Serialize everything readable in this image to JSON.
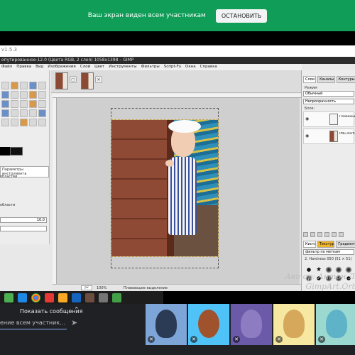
{
  "banner": {
    "text": "Ваш экран виден всем участникам",
    "stop_label": "ОСТАНОВИТЬ",
    "color": "#0f9d58"
  },
  "desktop": {
    "app_version": "v1.5.3"
  },
  "gimp": {
    "title": "опутированное-12.0 (Цвета RGB, 2 слоя) 1058x1398 – GIMP",
    "menu": [
      "Файл",
      "Правка",
      "Вид",
      "Изображение",
      "Слой",
      "Цвет",
      "Инструменты",
      "Фильтры",
      "Script-Fu",
      "Окна",
      "Справка"
    ],
    "toolbox": {
      "options_tab": "Параметры инструмента",
      "options_label": "областей",
      "mode_label": "области",
      "value_field": "10.0"
    },
    "tabs": [
      {
        "icon": "image-thumbnail-icon"
      },
      {
        "icon": "image-thumbnail-icon"
      }
    ],
    "statusbar": {
      "zoom": "px",
      "percent": "100%",
      "message": "Плавающее выделение"
    },
    "layers_dock": {
      "tabs": [
        "Слои",
        "Каналы",
        "Контуры"
      ],
      "mode_label": "Режим",
      "mode_value": "Обычный",
      "opacity_label": "Непрозрачность",
      "lock_label": "Блок:",
      "layers": [
        {
          "name": "Плавающее выделение (Вставленный слой)"
        },
        {
          "name": "PNG-Kartinki"
        }
      ]
    },
    "brushes_dock": {
      "tabs": [
        "Кисти",
        "Текстуры",
        "Градиенты"
      ],
      "filter_label": "фильтр по меткам",
      "brush_name": "2. Hardness 050 (51 × 51)"
    }
  },
  "watermark": {
    "line1": "Автор: Антон Л",
    "line2": "GimpArt.Ort"
  },
  "call": {
    "messages_label": "Показать сообщения",
    "message_placeholder": "ение всем участник...",
    "participant_tiles": 6
  }
}
